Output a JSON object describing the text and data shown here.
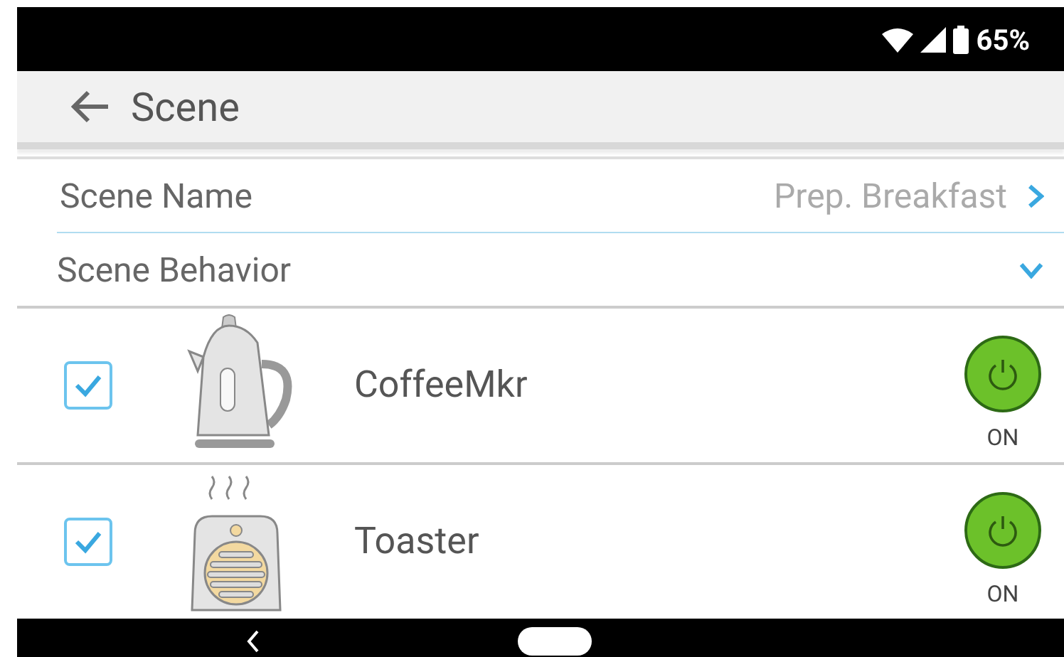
{
  "status_bar": {
    "battery": "65%"
  },
  "app_bar": {
    "title": "Scene"
  },
  "settings": [
    {
      "kind": "link",
      "label": "Scene Name",
      "value": "Prep. Breakfast"
    },
    {
      "kind": "expand",
      "label": "Scene Behavior",
      "expanded": false
    }
  ],
  "devices": [
    {
      "kind": "kettle",
      "name": "CoffeeMkr",
      "checked": true,
      "on": true,
      "state_label": "ON"
    },
    {
      "kind": "toaster",
      "name": "Toaster",
      "checked": true,
      "on": true,
      "state_label": "ON"
    }
  ]
}
